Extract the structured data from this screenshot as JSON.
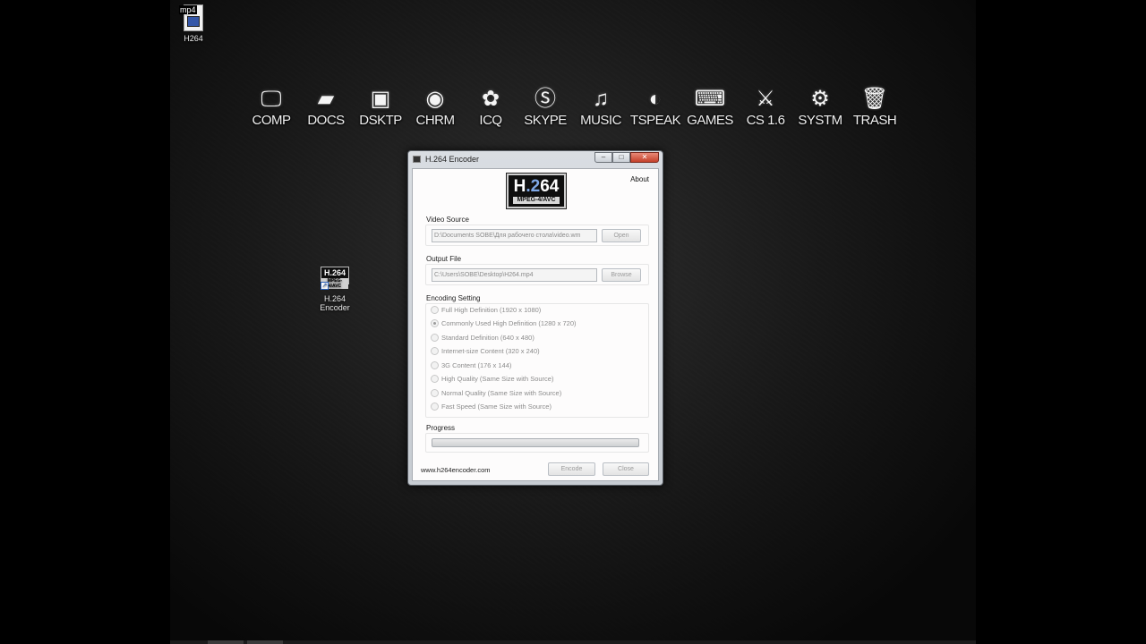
{
  "desktop": {
    "icons": [
      {
        "label": "H264",
        "badge": "mp4"
      },
      {
        "label_line1": "H.264",
        "label_line2": "Encoder",
        "logo_text": "H.264",
        "logo_sub": "MPEG-4/AVC"
      }
    ],
    "dock": [
      {
        "label": "COMP",
        "icon": "monitor-icon"
      },
      {
        "label": "DOCS",
        "icon": "folder-icon"
      },
      {
        "label": "DSKTP",
        "icon": "desktop-icon"
      },
      {
        "label": "CHRM",
        "icon": "chrome-icon"
      },
      {
        "label": "ICQ",
        "icon": "flower-icon"
      },
      {
        "label": "SKYPE",
        "icon": "skype-icon"
      },
      {
        "label": "MUSIC",
        "icon": "music-folder-icon"
      },
      {
        "label": "TSPEAK",
        "icon": "headset-icon"
      },
      {
        "label": "GAMES",
        "icon": "gamepad-icon"
      },
      {
        "label": "CS 1.6",
        "icon": "soldier-icon"
      },
      {
        "label": "SYSTM",
        "icon": "gears-icon"
      },
      {
        "label": "TRASH",
        "icon": "trash-icon"
      }
    ]
  },
  "window": {
    "title": "H.264 Encoder",
    "controls": {
      "minimize": "–",
      "maximize": "□",
      "close": "✕"
    },
    "logo": {
      "main_prefix": "H",
      "main_mid": ".2",
      "main_suffix": "64",
      "sub": "MPEG-4/AVC"
    },
    "about": "About",
    "video_source": {
      "label": "Video Source",
      "value": "D:\\Documents SOBE\\Для рабочего стола\\video.wm",
      "button": "Open"
    },
    "output_file": {
      "label": "Output File",
      "value": "C:\\Users\\SOBE\\Desktop\\H264.mp4",
      "button": "Browse"
    },
    "encoding": {
      "label": "Encoding Setting",
      "options": [
        {
          "label": "Full High Definition (1920 x 1080)",
          "checked": false
        },
        {
          "label": "Commonly Used High Definition (1280 x 720)",
          "checked": true
        },
        {
          "label": "Standard Definition (640 x 480)",
          "checked": false
        },
        {
          "label": "Internet-size Content (320 x 240)",
          "checked": false
        },
        {
          "label": "3G Content (176 x 144)",
          "checked": false
        },
        {
          "label": "High Quality (Same Size with Source)",
          "checked": false
        },
        {
          "label": "Normal Quality (Same Size with Source)",
          "checked": false
        },
        {
          "label": "Fast Speed (Same Size with Source)",
          "checked": false
        }
      ]
    },
    "progress": {
      "label": "Progress",
      "value": 0
    },
    "footer": {
      "link": "www.h264encoder.com",
      "encode": "Encode",
      "close": "Close"
    }
  },
  "colors": {
    "window_frame": "#d9dde2",
    "close_button": "#c4402a",
    "desktop_bg": "#111111"
  }
}
